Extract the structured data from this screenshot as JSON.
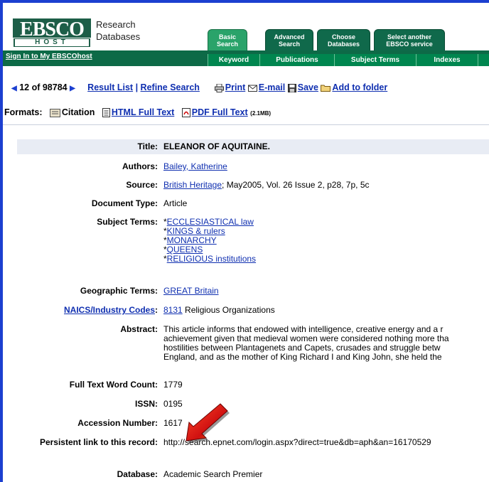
{
  "header": {
    "logo_top": "EBSCO",
    "logo_bottom": "HOST",
    "brand_line1": "Research",
    "brand_line2": "Databases",
    "signin": "Sign In to My EBSCOhost",
    "tabs": [
      {
        "l1": "Basic",
        "l2": "Search"
      },
      {
        "l1": "Advanced",
        "l2": "Search"
      },
      {
        "l1": "Choose",
        "l2": "Databases"
      },
      {
        "l1": "Select another",
        "l2": "EBSCO service"
      }
    ],
    "subtabs": [
      "Keyword",
      "Publications",
      "Subject Terms",
      "Indexes"
    ]
  },
  "nav": {
    "position": "12 of 98784",
    "result_list": "Result List",
    "divider": "|",
    "refine": "Refine Search",
    "print": "Print",
    "email": "E-mail",
    "save": "Save",
    "folder": "Add to folder"
  },
  "formats": {
    "label": "Formats:",
    "citation": "Citation",
    "html": "HTML Full Text",
    "pdf": "PDF Full Text",
    "pdf_size": "(2.1MB)"
  },
  "record": {
    "title_label": "Title:",
    "title": "ELEANOR OF AQUITAINE.",
    "authors_label": "Authors:",
    "authors": "Bailey, Katherine",
    "source_label": "Source:",
    "source_link": "British Heritage",
    "source_rest": "; May2005, Vol. 26 Issue 2, p28, 7p, 5c",
    "doctype_label": "Document Type:",
    "doctype": "Article",
    "subjects_label": "Subject Terms:",
    "subjects": [
      "ECCLESIASTICAL law",
      "KINGS & rulers",
      "MONARCHY",
      "QUEENS",
      "RELIGIOUS institutions"
    ],
    "star": "*",
    "geo_label": "Geographic Terms:",
    "geo": "GREAT Britain",
    "naics_label": "NAICS/Industry Codes",
    "naics_colon": ":",
    "naics_code": "8131",
    "naics_desc": "Religious Organizations",
    "abstract_label": "Abstract:",
    "abstract_lines": [
      "This article informs that endowed with intelligence, creative energy and a r",
      "achievement given that medieval women were considered nothing more tha",
      "hostilities between Plantagenets and Capets, crusades and struggle betw",
      "England, and as the mother of King Richard I and King John, she held the"
    ],
    "wordcount_label": "Full Text Word Count:",
    "wordcount": "1779",
    "issn_label": "ISSN:",
    "issn": "0195",
    "accession_label": "Accession Number:",
    "accession": "1617",
    "permalink_label": "Persistent link to this record:",
    "permalink": "http://search.epnet.com/login.aspx?direct=true&db=aph&an=16170529",
    "database_label": "Database:",
    "database": "Academic Search Premier"
  },
  "colors": {
    "frame": "#1c3fd0",
    "brand_green": "#0d6a47",
    "link": "#0f2fb0",
    "title_bg": "#e8ecf4"
  }
}
